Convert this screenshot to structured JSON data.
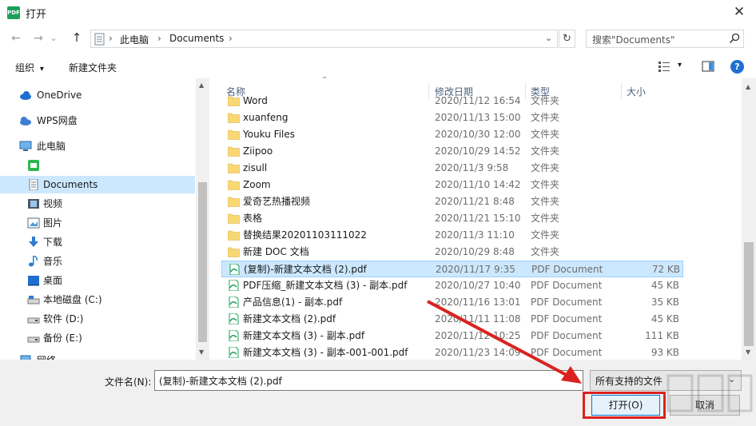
{
  "window": {
    "title": "打开",
    "close_glyph": "✕"
  },
  "nav": {
    "back": "←",
    "forward": "→",
    "dropdown": "⌄",
    "up": "↑",
    "path": [
      "此电脑",
      "Documents"
    ],
    "sep": "›",
    "refresh": "↻",
    "search_placeholder": "搜索\"Documents\""
  },
  "toolbar": {
    "organize": "组织",
    "organize_arrow": "▾",
    "new_folder": "新建文件夹",
    "help": "?"
  },
  "sidebar": {
    "items": [
      {
        "label": "OneDrive",
        "icon": "cloud-icon"
      },
      {
        "label": "WPS网盘",
        "icon": "cloud-icon"
      },
      {
        "label": "此电脑",
        "icon": "computer-icon"
      },
      {
        "label": "",
        "icon": "green-app-icon"
      },
      {
        "label": "Documents",
        "icon": "document-icon"
      },
      {
        "label": "视频",
        "icon": "video-icon"
      },
      {
        "label": "图片",
        "icon": "picture-icon"
      },
      {
        "label": "下载",
        "icon": "download-icon"
      },
      {
        "label": "音乐",
        "icon": "music-icon"
      },
      {
        "label": "桌面",
        "icon": "desktop-icon"
      },
      {
        "label": "本地磁盘 (C:)",
        "icon": "drive-icon"
      },
      {
        "label": "软件 (D:)",
        "icon": "drive-icon"
      },
      {
        "label": "备份 (E:)",
        "icon": "drive-icon"
      },
      {
        "label": "网络",
        "icon": "network-icon"
      }
    ]
  },
  "columns": {
    "name": "名称",
    "date": "修改日期",
    "type": "类型",
    "size": "大小",
    "sort_arrow": "^"
  },
  "files": [
    {
      "name": "Word",
      "date": "2020/11/12 16:54",
      "type": "文件夹",
      "size": "",
      "kind": "folder"
    },
    {
      "name": "xuanfeng",
      "date": "2020/11/13 15:00",
      "type": "文件夹",
      "size": "",
      "kind": "folder"
    },
    {
      "name": "Youku Files",
      "date": "2020/10/30 12:00",
      "type": "文件夹",
      "size": "",
      "kind": "folder"
    },
    {
      "name": "Ziipoo",
      "date": "2020/10/29 14:52",
      "type": "文件夹",
      "size": "",
      "kind": "folder"
    },
    {
      "name": "zisull",
      "date": "2020/11/3 9:58",
      "type": "文件夹",
      "size": "",
      "kind": "folder"
    },
    {
      "name": "Zoom",
      "date": "2020/11/10 14:42",
      "type": "文件夹",
      "size": "",
      "kind": "folder"
    },
    {
      "name": "爱奇艺热播视频",
      "date": "2020/11/21 8:48",
      "type": "文件夹",
      "size": "",
      "kind": "folder"
    },
    {
      "name": "表格",
      "date": "2020/11/21 15:10",
      "type": "文件夹",
      "size": "",
      "kind": "folder"
    },
    {
      "name": "替换结果20201103111022",
      "date": "2020/11/3 11:10",
      "type": "文件夹",
      "size": "",
      "kind": "folder"
    },
    {
      "name": "新建 DOC 文档",
      "date": "2020/10/29 8:48",
      "type": "文件夹",
      "size": "",
      "kind": "folder"
    },
    {
      "name": "(复制)-新建文本文档 (2).pdf",
      "date": "2020/11/17 9:35",
      "type": "PDF Document",
      "size": "72 KB",
      "kind": "pdf",
      "selected": true
    },
    {
      "name": "PDF压缩_新建文本文档 (3) - 副本.pdf",
      "date": "2020/10/27 10:40",
      "type": "PDF Document",
      "size": "45 KB",
      "kind": "pdf"
    },
    {
      "name": "产品信息(1) - 副本.pdf",
      "date": "2020/11/16 13:01",
      "type": "PDF Document",
      "size": "35 KB",
      "kind": "pdf"
    },
    {
      "name": "新建文本文档 (2).pdf",
      "date": "2020/11/11 11:08",
      "type": "PDF Document",
      "size": "45 KB",
      "kind": "pdf"
    },
    {
      "name": "新建文本文档 (3) - 副本.pdf",
      "date": "2020/11/12 10:25",
      "type": "PDF Document",
      "size": "111 KB",
      "kind": "pdf"
    },
    {
      "name": "新建文本文档 (3) - 副本-001-001.pdf",
      "date": "2020/11/23 14:09",
      "type": "PDF Document",
      "size": "93 KB",
      "kind": "pdf"
    }
  ],
  "bottom": {
    "filename_label": "文件名(N):",
    "filename_value": "(复制)-新建文本文档 (2).pdf",
    "filter_value": "所有支持的文件",
    "open_label": "打开(O)",
    "cancel_label": "取消"
  },
  "colors": {
    "selection": "#cce8ff",
    "annotation_red": "#d9221f",
    "folder": "#f8d775",
    "pdf_green": "#1aa05a"
  }
}
